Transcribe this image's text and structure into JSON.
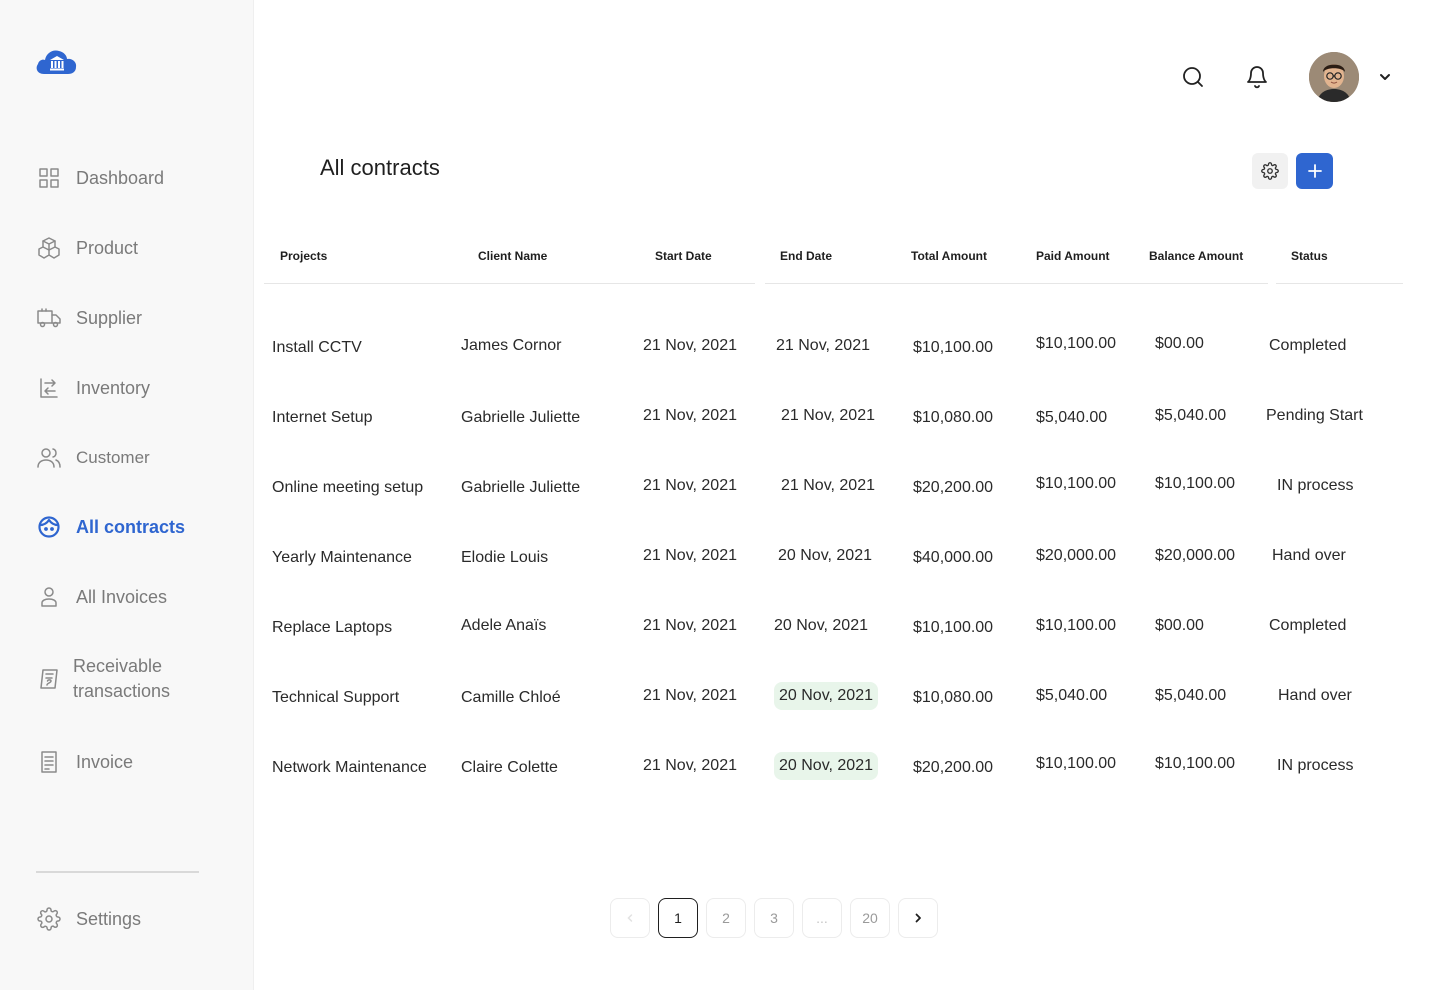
{
  "sidebar": {
    "items": [
      {
        "label": "Dashboard",
        "icon": "grid-icon"
      },
      {
        "label": "Product",
        "icon": "boxes-icon"
      },
      {
        "label": "Supplier",
        "icon": "truck-icon"
      },
      {
        "label": "Inventory",
        "icon": "inventory-icon"
      },
      {
        "label": "Customer",
        "icon": "users-icon"
      },
      {
        "label": "All contracts",
        "icon": "face-icon",
        "active": true
      },
      {
        "label": "All Invoices",
        "icon": "person-icon"
      },
      {
        "label": "Receivable transactions",
        "line1": "Receivable",
        "line2": "transactions",
        "icon": "receipt-icon"
      },
      {
        "label": "Invoice",
        "icon": "invoice-icon"
      }
    ],
    "settings_label": "Settings"
  },
  "header": {
    "title": "All contracts"
  },
  "table": {
    "columns": [
      "Projects",
      "Client Name",
      "Start Date",
      "End Date",
      "Total Amount",
      "Paid Amount",
      "Balance Amount",
      "Status"
    ],
    "rows": [
      [
        "Install CCTV",
        "James Cornor",
        "21 Nov, 2021",
        "21 Nov, 2021",
        "$10,100.00",
        "$10,100.00",
        "$00.00",
        "Completed"
      ],
      [
        "Internet Setup",
        "Gabrielle Juliette",
        "21 Nov, 2021",
        "21 Nov, 2021",
        "$10,080.00",
        "$5,040.00",
        "$5,040.00",
        "Pending Start"
      ],
      [
        "Online meeting setup",
        "Gabrielle Juliette",
        "21 Nov, 2021",
        "21 Nov, 2021",
        "$20,200.00",
        "$10,100.00",
        "$10,100.00",
        "IN process"
      ],
      [
        "Yearly Maintenance",
        "Elodie Louis",
        "21 Nov, 2021",
        "20 Nov, 2021",
        "$40,000.00",
        "$20,000.00",
        "$20,000.00",
        "Hand over"
      ],
      [
        "Replace Laptops",
        "Adele Anaïs",
        "21 Nov, 2021",
        "20 Nov, 2021",
        "$10,100.00",
        "$10,100.00",
        "$00.00",
        "Completed"
      ],
      [
        "Technical Support",
        "Camille Chloé",
        "21 Nov, 2021",
        "20 Nov, 2021",
        "$10,080.00",
        "$5,040.00",
        "$5,040.00",
        "Hand over"
      ],
      [
        "Network Maintenance",
        "Claire Colette",
        "21 Nov, 2021",
        "20 Nov, 2021",
        "$20,200.00",
        "$10,100.00",
        "$10,100.00",
        "IN process"
      ]
    ]
  },
  "pagination": {
    "pages": [
      "1",
      "2",
      "3",
      "...",
      "20"
    ],
    "current": "1"
  },
  "colors": {
    "accent": "#2f66d0",
    "highlight": "#e8f5ea"
  }
}
